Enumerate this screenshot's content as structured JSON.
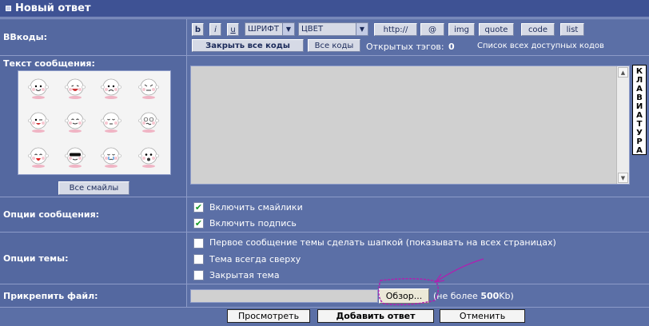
{
  "title": "Новый ответ",
  "bbcodes": {
    "label": "BBкоды:",
    "bold": "b",
    "italic": "i",
    "underline": "u",
    "font_select": "ШРИФТ",
    "color_select": "ЦВЕТ",
    "http": "http://",
    "email": "@",
    "img": "img",
    "quote": "quote",
    "code": "code",
    "list": "list",
    "close_all": "Закрыть все коды",
    "all_codes": "Все коды",
    "open_tags_label": "Открытых тэгов:",
    "open_tags_count": "0",
    "all_codes_link": "Список всех доступных кодов"
  },
  "message": {
    "label": "Текст сообщения:",
    "all_smilies": "Все смайлы",
    "keyboard": [
      "К",
      "Л",
      "А",
      "В",
      "И",
      "А",
      "Т",
      "У",
      "Р",
      "А"
    ],
    "text": ""
  },
  "msg_options": {
    "label": "Опции сообщения:",
    "items": [
      {
        "label": "Включить смайлики",
        "checked": true
      },
      {
        "label": "Включить подпись",
        "checked": true
      }
    ]
  },
  "topic_options": {
    "label": "Опции темы:",
    "items": [
      {
        "label": "Первое сообщение темы сделать шапкой (показывать на всех страницах)",
        "checked": false
      },
      {
        "label": "Тема всегда сверху",
        "checked": false
      },
      {
        "label": "Закрытая тема",
        "checked": false
      }
    ]
  },
  "attach": {
    "label": "Прикрепить файл:",
    "browse": "Обзор...",
    "limit_prefix": "(не более ",
    "limit_value": "500",
    "limit_suffix": "Kb)"
  },
  "actions": {
    "preview": "Просмотреть",
    "submit": "Добавить ответ",
    "cancel": "Отменить"
  },
  "colors": {
    "background": "#5b6fa6",
    "titlebar": "#3e5294",
    "annotation": "#b020b0"
  }
}
